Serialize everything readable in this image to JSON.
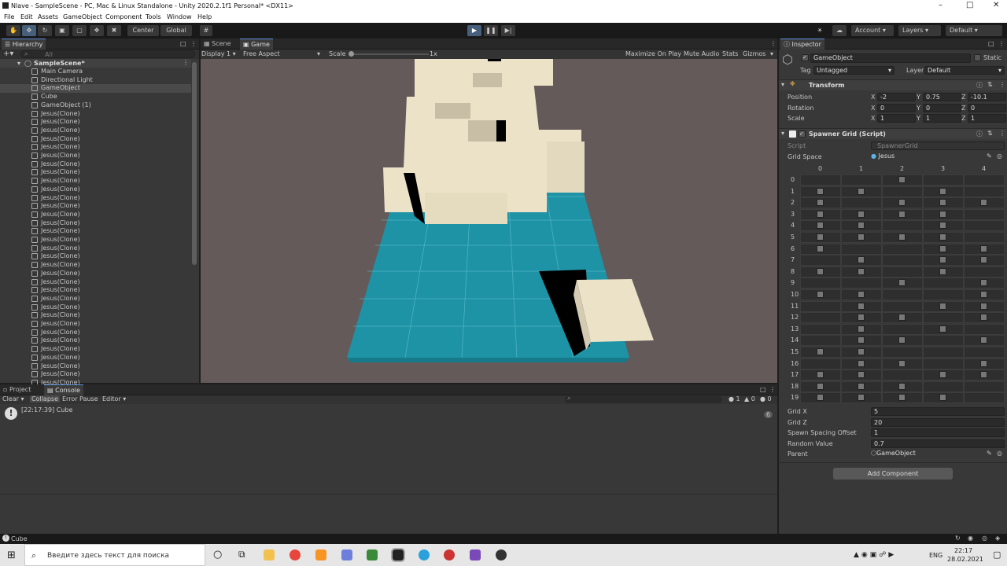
{
  "window": {
    "title": "Nlave - SampleScene - PC, Mac & Linux Standalone - Unity 2020.2.1f1 Personal* <DX11>"
  },
  "menu": [
    "File",
    "Edit",
    "Assets",
    "GameObject",
    "Component",
    "Tools",
    "Window",
    "Help"
  ],
  "toolbar": {
    "center": "Center",
    "global": "Global",
    "account": "Account",
    "layers": "Layers",
    "layout": "Default"
  },
  "hierarchy": {
    "tab": "Hierarchy",
    "search_placeholder": "All",
    "scene": "SampleScene*",
    "items": [
      "Main Camera",
      "Directional Light",
      "GameObject",
      "Cube",
      "GameObject (1)",
      "Jesus(Clone)",
      "Jesus(Clone)",
      "Jesus(Clone)",
      "Jesus(Clone)",
      "Jesus(Clone)",
      "Jesus(Clone)",
      "Jesus(Clone)",
      "Jesus(Clone)",
      "Jesus(Clone)",
      "Jesus(Clone)",
      "Jesus(Clone)",
      "Jesus(Clone)",
      "Jesus(Clone)",
      "Jesus(Clone)",
      "Jesus(Clone)",
      "Jesus(Clone)",
      "Jesus(Clone)",
      "Jesus(Clone)",
      "Jesus(Clone)",
      "Jesus(Clone)",
      "Jesus(Clone)",
      "Jesus(Clone)",
      "Jesus(Clone)",
      "Jesus(Clone)",
      "Jesus(Clone)",
      "Jesus(Clone)",
      "Jesus(Clone)",
      "Jesus(Clone)",
      "Jesus(Clone)",
      "Jesus(Clone)",
      "Jesus(Clone)",
      "Jesus(Clone)",
      "Jesus(Clone)",
      "Jesus(Clone)",
      "Jesus(Clone)",
      "Jesus(Clone)"
    ]
  },
  "game": {
    "tab_scene": "Scene",
    "tab_game": "Game",
    "display": "Display 1",
    "aspect": "Free Aspect",
    "scale_label": "Scale",
    "scale_value": "1x",
    "max": "Maximize On Play",
    "mute": "Mute Audio",
    "stats": "Stats",
    "gizmos": "Gizmos"
  },
  "bottom": {
    "tab_project": "Project",
    "tab_console": "Console",
    "clear": "Clear",
    "collapse": "Collapse",
    "error_pause": "Error Pause",
    "editor": "Editor",
    "log_text": "[22:17:39] Cube",
    "log_count": "6",
    "count_info": "1",
    "count_warn": "0",
    "count_err": "0"
  },
  "inspector": {
    "tab": "Inspector",
    "go_name": "GameObject",
    "static": "Static",
    "tag_label": "Tag",
    "tag": "Untagged",
    "layer_label": "Layer",
    "layer": "Default",
    "transform": {
      "title": "Transform",
      "pos": "Position",
      "rot": "Rotation",
      "scale": "Scale",
      "px": "-2",
      "py": "0.75",
      "pz": "-10.1",
      "rx": "0",
      "ry": "0",
      "rz": "0",
      "sx": "1",
      "sy": "1",
      "sz": "1",
      "xl": "X",
      "yl": "Y",
      "zl": "Z"
    },
    "spawner": {
      "title": "Spawner Grid (Script)",
      "script_label": "Script",
      "script": "SpawnerGrid",
      "gridspace_label": "Grid Space",
      "gridspace": "Jesus",
      "cols": [
        "0",
        "1",
        "2",
        "3",
        "4"
      ],
      "rows": [
        "0",
        "1",
        "2",
        "3",
        "4",
        "5",
        "6",
        "7",
        "8",
        "9",
        "10",
        "11",
        "12",
        "13",
        "14",
        "15",
        "16",
        "17",
        "18",
        "19"
      ],
      "gridx_label": "Grid X",
      "gridx": "5",
      "gridz_label": "Grid Z",
      "gridz": "20",
      "spacing_label": "Spawn Spacing Offset",
      "spacing": "1",
      "random_label": "Random Value",
      "random": "0.7",
      "parent_label": "Parent",
      "parent": "GameObject"
    },
    "add_component": "Add Component"
  },
  "status": {
    "text": "Cube"
  },
  "taskbar": {
    "search": "Введите здесь текст для поиска",
    "lang": "ENG",
    "time": "22:17",
    "date": "28.02.2021"
  },
  "colors": {
    "accent": "#5a8bd6",
    "floor": "#1f93a6",
    "block": "#ebe2c8",
    "viewport": "#655a5a"
  }
}
